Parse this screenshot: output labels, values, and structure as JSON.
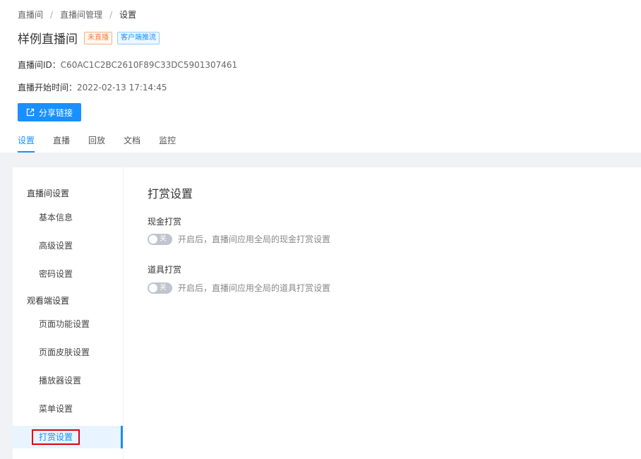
{
  "breadcrumb": {
    "items": [
      "直播间",
      "直播间管理",
      "设置"
    ],
    "separator": "/"
  },
  "header": {
    "title": "样例直播间",
    "status_badge": "未直播",
    "push_badge": "客户端推流"
  },
  "info": {
    "room_id_label": "直播间ID：",
    "room_id_value": "C60AC1C2BC2610F89C33DC5901307461",
    "start_time_label": "直播开始时间：",
    "start_time_value": "2022-02-13 17:14:45"
  },
  "share_button": {
    "label": "分享链接",
    "icon": "share-icon"
  },
  "tabs": [
    {
      "label": "设置",
      "active": true
    },
    {
      "label": "直播",
      "active": false
    },
    {
      "label": "回放",
      "active": false
    },
    {
      "label": "文档",
      "active": false
    },
    {
      "label": "监控",
      "active": false
    }
  ],
  "side_nav": {
    "group1": "直播间设置",
    "group1_items": [
      "基本信息",
      "高级设置",
      "密码设置"
    ],
    "group2": "观看端设置",
    "group2_items": [
      "页面功能设置",
      "页面皮肤设置",
      "播放器设置",
      "菜单设置",
      "打赏设置"
    ],
    "active_item": "打赏设置"
  },
  "content": {
    "title": "打赏设置",
    "cash": {
      "label": "现金打赏",
      "toggle_text": "关",
      "enabled": false,
      "hint": "开启后，直播间应用全局的现金打赏设置"
    },
    "prop": {
      "label": "道具打赏",
      "toggle_text": "关",
      "enabled": false,
      "hint": "开启后，直播间应用全局的道具打赏设置"
    }
  },
  "colors": {
    "primary": "#1890ff",
    "badge_orange": "#f5803e",
    "highlight_red": "#e0000f"
  }
}
